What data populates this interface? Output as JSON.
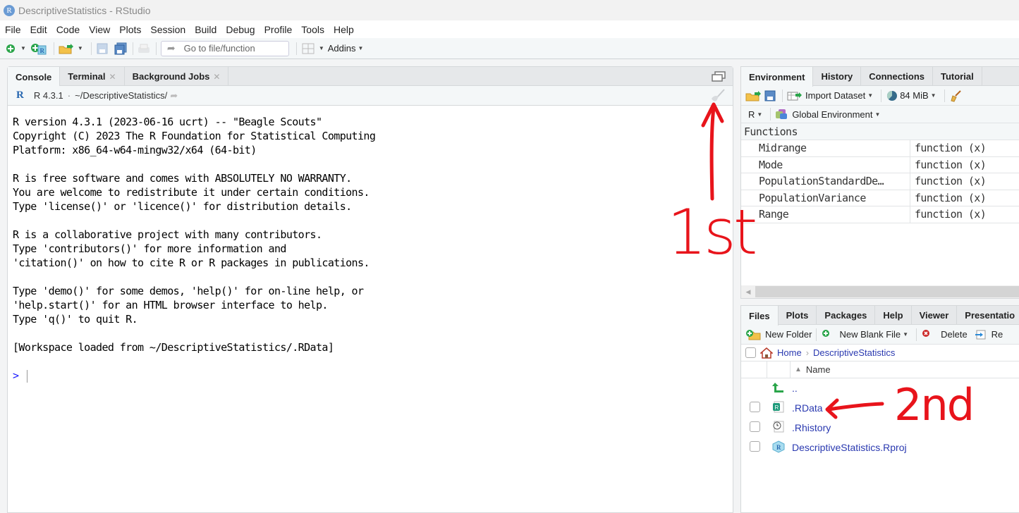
{
  "window": {
    "title": "DescriptiveStatistics - RStudio",
    "logo": "R"
  },
  "menu": [
    "File",
    "Edit",
    "Code",
    "View",
    "Plots",
    "Session",
    "Build",
    "Debug",
    "Profile",
    "Tools",
    "Help"
  ],
  "toolbar": {
    "goto_placeholder": "Go to file/function",
    "addins_label": "Addins",
    "icons": [
      "new-file-icon",
      "new-project-icon",
      "open-file-icon",
      "save-icon",
      "save-all-icon",
      "print-icon",
      "goto-arrow-icon",
      "pane-layout-icon"
    ]
  },
  "console_pane": {
    "tabs": [
      {
        "label": "Console",
        "active": true,
        "closable": false
      },
      {
        "label": "Terminal",
        "active": false,
        "closable": true
      },
      {
        "label": "Background Jobs",
        "active": false,
        "closable": true
      }
    ],
    "r_version": "R 4.3.1",
    "separator": "·",
    "working_dir": "~/DescriptiveStatistics/",
    "output_lines": [
      "R version 4.3.1 (2023-06-16 ucrt) -- \"Beagle Scouts\"",
      "Copyright (C) 2023 The R Foundation for Statistical Computing",
      "Platform: x86_64-w64-mingw32/x64 (64-bit)",
      "",
      "R is free software and comes with ABSOLUTELY NO WARRANTY.",
      "You are welcome to redistribute it under certain conditions.",
      "Type 'license()' or 'licence()' for distribution details.",
      "",
      "R is a collaborative project with many contributors.",
      "Type 'contributors()' for more information and",
      "'citation()' on how to cite R or R packages in publications.",
      "",
      "Type 'demo()' for some demos, 'help()' for on-line help, or",
      "'help.start()' for an HTML browser interface to help.",
      "Type 'q()' to quit R.",
      "",
      "[Workspace loaded from ~/DescriptiveStatistics/.RData]",
      ""
    ],
    "prompt": ">"
  },
  "env_pane": {
    "tabs": [
      {
        "label": "Environment",
        "active": true
      },
      {
        "label": "History",
        "active": false
      },
      {
        "label": "Connections",
        "active": false
      },
      {
        "label": "Tutorial",
        "active": false
      }
    ],
    "import_label": "Import Dataset",
    "memory_label": "84 MiB",
    "language": "R",
    "scope": "Global Environment",
    "section": "Functions",
    "rows": [
      {
        "name": "Midrange",
        "value": "function (x)"
      },
      {
        "name": "Mode",
        "value": "function (x)"
      },
      {
        "name": "PopulationStandardDe…",
        "value": "function (x)"
      },
      {
        "name": "PopulationVariance",
        "value": "function (x)"
      },
      {
        "name": "Range",
        "value": "function (x)"
      }
    ]
  },
  "files_pane": {
    "tabs": [
      {
        "label": "Files",
        "active": true
      },
      {
        "label": "Plots",
        "active": false
      },
      {
        "label": "Packages",
        "active": false
      },
      {
        "label": "Help",
        "active": false
      },
      {
        "label": "Viewer",
        "active": false
      },
      {
        "label": "Presentatio",
        "active": false
      }
    ],
    "new_folder": "New Folder",
    "new_blank_file": "New Blank File",
    "delete": "Delete",
    "rename_partial": "Re",
    "breadcrumb": [
      "Home",
      "DescriptiveStatistics"
    ],
    "column_name": "Name",
    "parent_label": "..",
    "files": [
      {
        "name": ".RData",
        "icon": "rdata-file-icon"
      },
      {
        "name": ".Rhistory",
        "icon": "rhistory-file-icon"
      },
      {
        "name": "DescriptiveStatistics.Rproj",
        "icon": "rproj-file-icon"
      }
    ]
  },
  "annotations": {
    "first": "1st",
    "second": "2nd",
    "color": "#e8141b"
  }
}
